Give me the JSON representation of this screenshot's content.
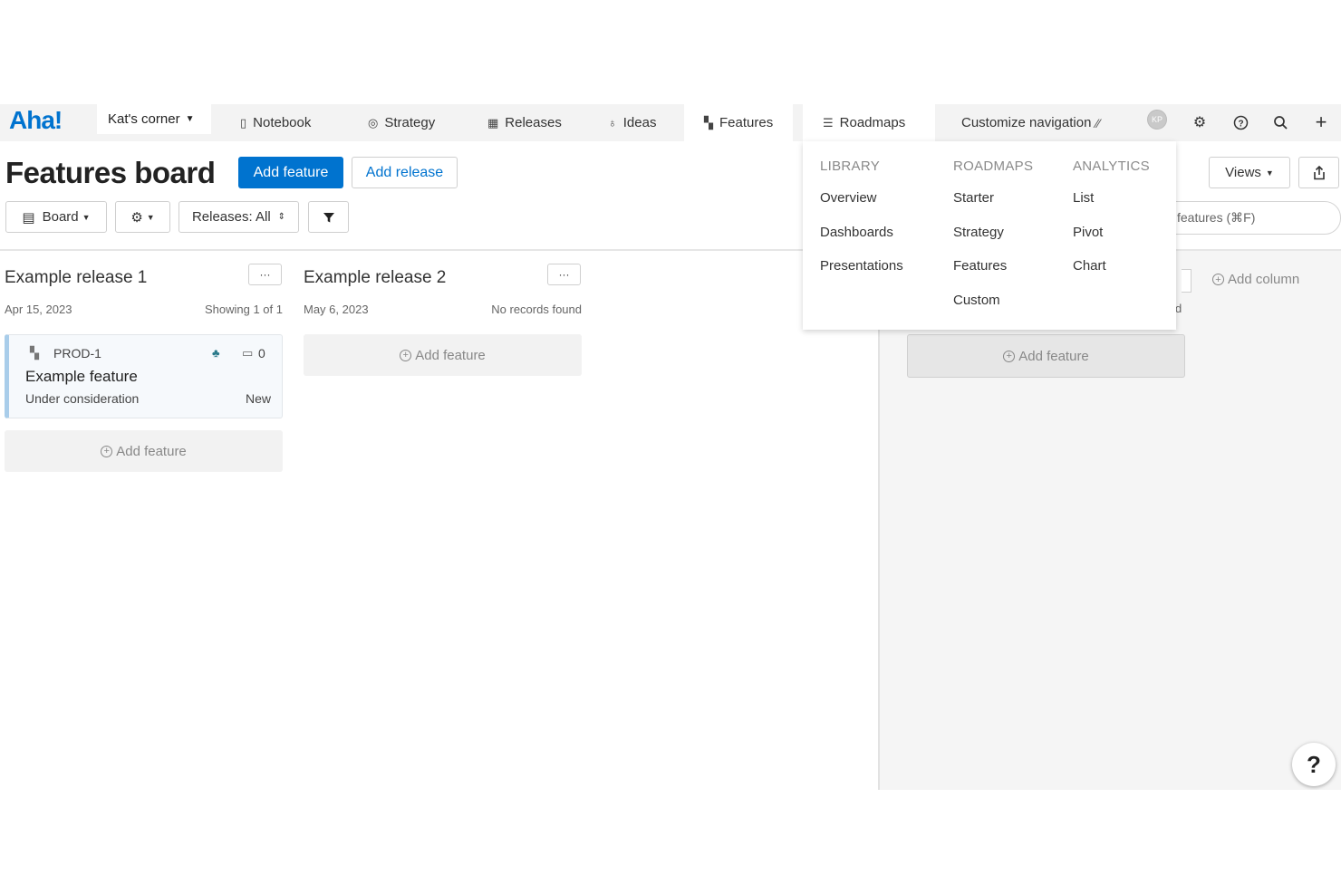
{
  "brand": "Aha!",
  "workspace": "Kat's corner",
  "nav": {
    "notebook": "Notebook",
    "strategy": "Strategy",
    "releases": "Releases",
    "ideas": "Ideas",
    "features": "Features",
    "roadmaps": "Roadmaps",
    "customize": "Customize navigation",
    "avatar_initials": "KP"
  },
  "header": {
    "title": "Features board",
    "add_feature": "Add feature",
    "add_release": "Add release",
    "views": "Views",
    "board": "Board",
    "releases_filter": "Releases: All",
    "search_placeholder": "features (⌘F)"
  },
  "dropdown": {
    "library": {
      "heading": "LIBRARY",
      "items": [
        "Overview",
        "Dashboards",
        "Presentations"
      ]
    },
    "roadmaps": {
      "heading": "ROADMAPS",
      "items": [
        "Starter",
        "Strategy",
        "Features",
        "Custom"
      ]
    },
    "analytics": {
      "heading": "ANALYTICS",
      "items": [
        "List",
        "Pivot",
        "Chart"
      ]
    }
  },
  "columns": [
    {
      "title": "Example release 1",
      "date": "Apr 15, 2023",
      "status": "Showing 1 of 1"
    },
    {
      "title": "Example release 2",
      "date": "May 6, 2023",
      "status": "No records found"
    }
  ],
  "card": {
    "id": "PROD-1",
    "title": "Example feature",
    "status": "Under consideration",
    "tag": "New",
    "comments": "0"
  },
  "add_feature_label": "Add feature",
  "add_column_label": "Add column",
  "hidden_col_fragment": "d",
  "help": "?",
  "colors": {
    "primary": "#0073cf",
    "card_border": "#a9cdea"
  }
}
